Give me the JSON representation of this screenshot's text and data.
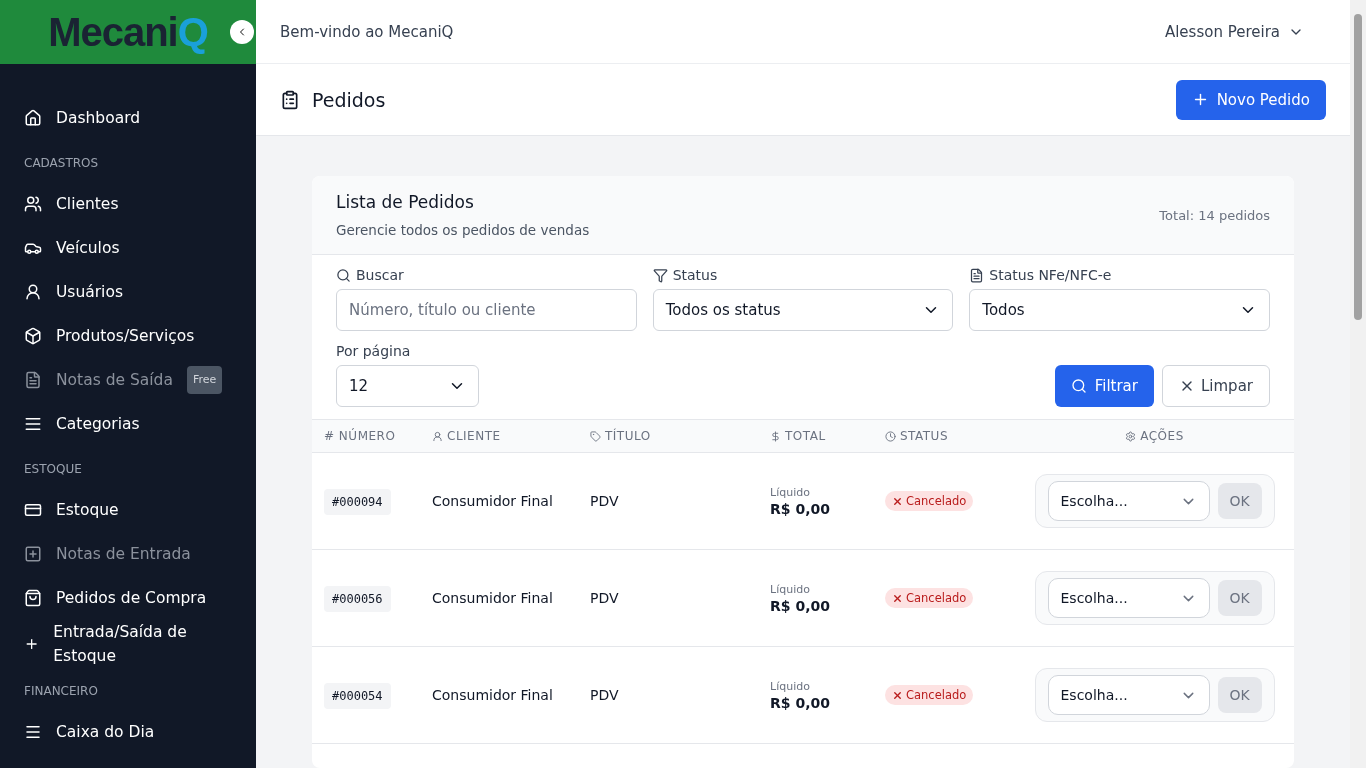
{
  "sidebar": {
    "logo": {
      "text": "Mecani",
      "accent": "Q"
    },
    "sections": [
      {
        "items": [
          {
            "label": "Dashboard",
            "disabled": false
          }
        ]
      },
      {
        "heading": "CADASTROS",
        "items": [
          {
            "label": "Clientes",
            "disabled": false
          },
          {
            "label": "Veículos",
            "disabled": false
          },
          {
            "label": "Usuários",
            "disabled": false
          },
          {
            "label": "Produtos/Serviços",
            "disabled": false
          },
          {
            "label": "Notas de Saída",
            "disabled": true,
            "badge": "Free"
          },
          {
            "label": "Categorias",
            "disabled": false
          }
        ]
      },
      {
        "heading": "ESTOQUE",
        "items": [
          {
            "label": "Estoque",
            "disabled": false
          },
          {
            "label": "Notas de Entrada",
            "disabled": true
          },
          {
            "label": "Pedidos de Compra",
            "disabled": false
          },
          {
            "label": "Entrada/Saída de Estoque",
            "disabled": false
          }
        ]
      },
      {
        "heading": "FINANCEIRO",
        "items": [
          {
            "label": "Caixa do Dia",
            "disabled": false
          }
        ]
      }
    ]
  },
  "topbar": {
    "welcome": "Bem-vindo ao MecaniQ",
    "user": "Alesson Pereira"
  },
  "page": {
    "title": "Pedidos",
    "new_button": "Novo Pedido"
  },
  "card": {
    "title": "Lista de Pedidos",
    "subtitle": "Gerencie todos os pedidos de vendas",
    "total": "Total: 14 pedidos",
    "filters": {
      "search": {
        "label": "Buscar",
        "placeholder": "Número, título ou cliente"
      },
      "status": {
        "label": "Status",
        "value": "Todos os status"
      },
      "nfe": {
        "label": "Status NFe/NFC-e",
        "value": "Todos"
      },
      "per_page": {
        "label": "Por página",
        "value": "12"
      },
      "filter_button": "Filtrar",
      "clear_button": "Limpar"
    },
    "table": {
      "columns": [
        "# NÚMERO",
        "CLIENTE",
        "TÍTULO",
        "TOTAL",
        "STATUS",
        "AÇÕES"
      ],
      "rows": [
        {
          "number": "#000094",
          "client": "Consumidor Final",
          "title": "PDV",
          "total_label": "Líquido",
          "total": "R$ 0,00",
          "status": "Cancelado",
          "action": "Escolha...",
          "ok": "OK"
        },
        {
          "number": "#000056",
          "client": "Consumidor Final",
          "title": "PDV",
          "total_label": "Líquido",
          "total": "R$ 0,00",
          "status": "Cancelado",
          "action": "Escolha...",
          "ok": "OK"
        },
        {
          "number": "#000054",
          "client": "Consumidor Final",
          "title": "PDV",
          "total_label": "Líquido",
          "total": "R$ 0,00",
          "status": "Cancelado",
          "action": "Escolha...",
          "ok": "OK"
        }
      ]
    }
  }
}
